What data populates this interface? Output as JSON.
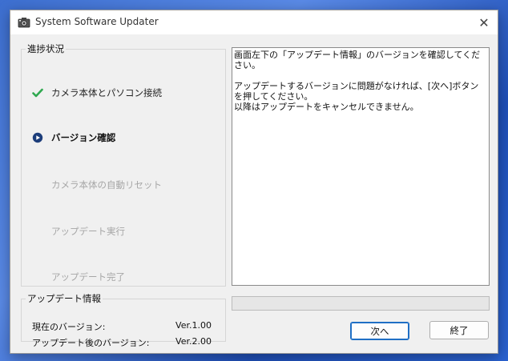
{
  "window": {
    "title": "System Software Updater",
    "icon": "camera-app-icon",
    "close_glyph": "✕"
  },
  "progress": {
    "legend": "進捗状況",
    "steps": [
      {
        "label": "カメラ本体とパソコン接続",
        "state": "done",
        "icon": "checkmark-icon"
      },
      {
        "label": "バージョン確認",
        "state": "current",
        "icon": "play-circle-icon"
      },
      {
        "label": "カメラ本体の自動リセット",
        "state": "pending",
        "icon": ""
      },
      {
        "label": "アップデート実行",
        "state": "pending",
        "icon": ""
      },
      {
        "label": "アップデート完了",
        "state": "pending",
        "icon": ""
      }
    ]
  },
  "message": {
    "line1": "画面左下の「アップデート情報」のバージョンを確認してください。",
    "line2": "アップデートするバージョンに問題がなければ、[次へ]ボタンを押してください。",
    "line3": "以降はアップデートをキャンセルできません。"
  },
  "update_info": {
    "legend": "アップデート情報",
    "current_label": "現在のバージョン:",
    "current_value": "Ver.1.00",
    "after_label": "アップデート後のバージョン:",
    "after_value": "Ver.2.00"
  },
  "update_progress": {
    "fraction": 0.0
  },
  "buttons": {
    "next_label": "次へ",
    "finish_label": "終了"
  },
  "colors": {
    "check": "#2fa84f",
    "current_marker": "#1c3d7a",
    "progress_fill": "#06b025",
    "default_button_border": "#1f6fc5"
  }
}
